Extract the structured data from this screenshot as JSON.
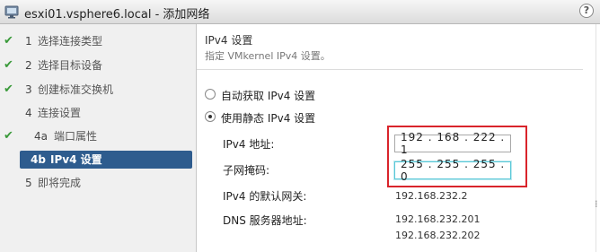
{
  "window": {
    "title": "esxi01.vsphere6.local - 添加网络",
    "help_label": "?",
    "icon": "add-network-icon"
  },
  "steps": [
    {
      "num": "1",
      "label": "选择连接类型",
      "done": true,
      "active": false
    },
    {
      "num": "2",
      "label": "选择目标设备",
      "done": true,
      "active": false
    },
    {
      "num": "3",
      "label": "创建标准交换机",
      "done": true,
      "active": false
    },
    {
      "num": "4",
      "label": "连接设置",
      "done": false,
      "active": false
    },
    {
      "num": "4a",
      "label": "端口属性",
      "done": true,
      "active": false
    },
    {
      "num": "4b",
      "label": "IPv4 设置",
      "done": false,
      "active": true
    },
    {
      "num": "5",
      "label": "即将完成",
      "done": false,
      "active": false
    }
  ],
  "section": {
    "title": "IPv4 设置",
    "subtitle": "指定 VMkernel IPv4 设置。"
  },
  "options": {
    "auto": "自动获取 IPv4 设置",
    "static": "使用静态 IPv4 设置",
    "selected": "static"
  },
  "fields": {
    "ipv4_address_label": "IPv4 地址:",
    "ipv4_address_value": "192 . 168 . 222 .  1",
    "subnet_label": "子网掩码:",
    "subnet_value": "255 . 255 . 255 .  0",
    "gateway_label": "IPv4 的默认网关:",
    "gateway_value": "192.168.232.2",
    "dns_label": "DNS 服务器地址:",
    "dns_value_1": "192.168.232.201",
    "dns_value_2": "192.168.232.202"
  },
  "colors": {
    "active_step_bg": "#2e5c8e",
    "check": "#3a9a3a",
    "highlight": "#d9242b",
    "focus": "#58c8d8"
  }
}
